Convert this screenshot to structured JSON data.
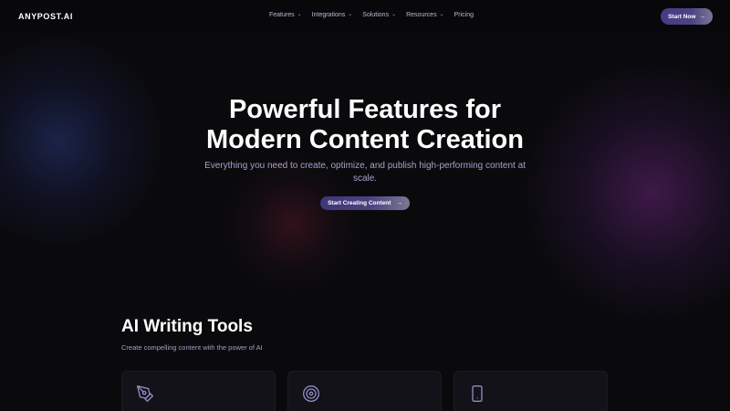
{
  "header": {
    "logo": "ANYPOST.AI",
    "nav": [
      {
        "label": "Features",
        "has_dropdown": true
      },
      {
        "label": "Integrations",
        "has_dropdown": true
      },
      {
        "label": "Solutions",
        "has_dropdown": true
      },
      {
        "label": "Resources",
        "has_dropdown": true
      },
      {
        "label": "Pricing",
        "has_dropdown": false
      }
    ],
    "chevron_glyph": "⌄",
    "cta_label": "Start Now",
    "cta_arrow": "→"
  },
  "hero": {
    "title_line1": "Powerful Features for",
    "title_line2": "Modern Content Creation",
    "subtitle": "Everything you need to create, optimize, and publish high-performing content at scale.",
    "cta_label": "Start Creating Content",
    "cta_arrow": "→"
  },
  "section": {
    "title": "AI Writing Tools",
    "subtitle": "Create compelling content with the power of AI",
    "cards": [
      {
        "icon": "pen-tool-icon"
      },
      {
        "icon": "target-icon"
      },
      {
        "icon": "smartphone-icon"
      }
    ]
  },
  "colors": {
    "background": "#0a0a0d",
    "accent": "#453b86",
    "subtitle_text": "#a5a2cc",
    "icon_stroke": "#8f8cc4"
  }
}
